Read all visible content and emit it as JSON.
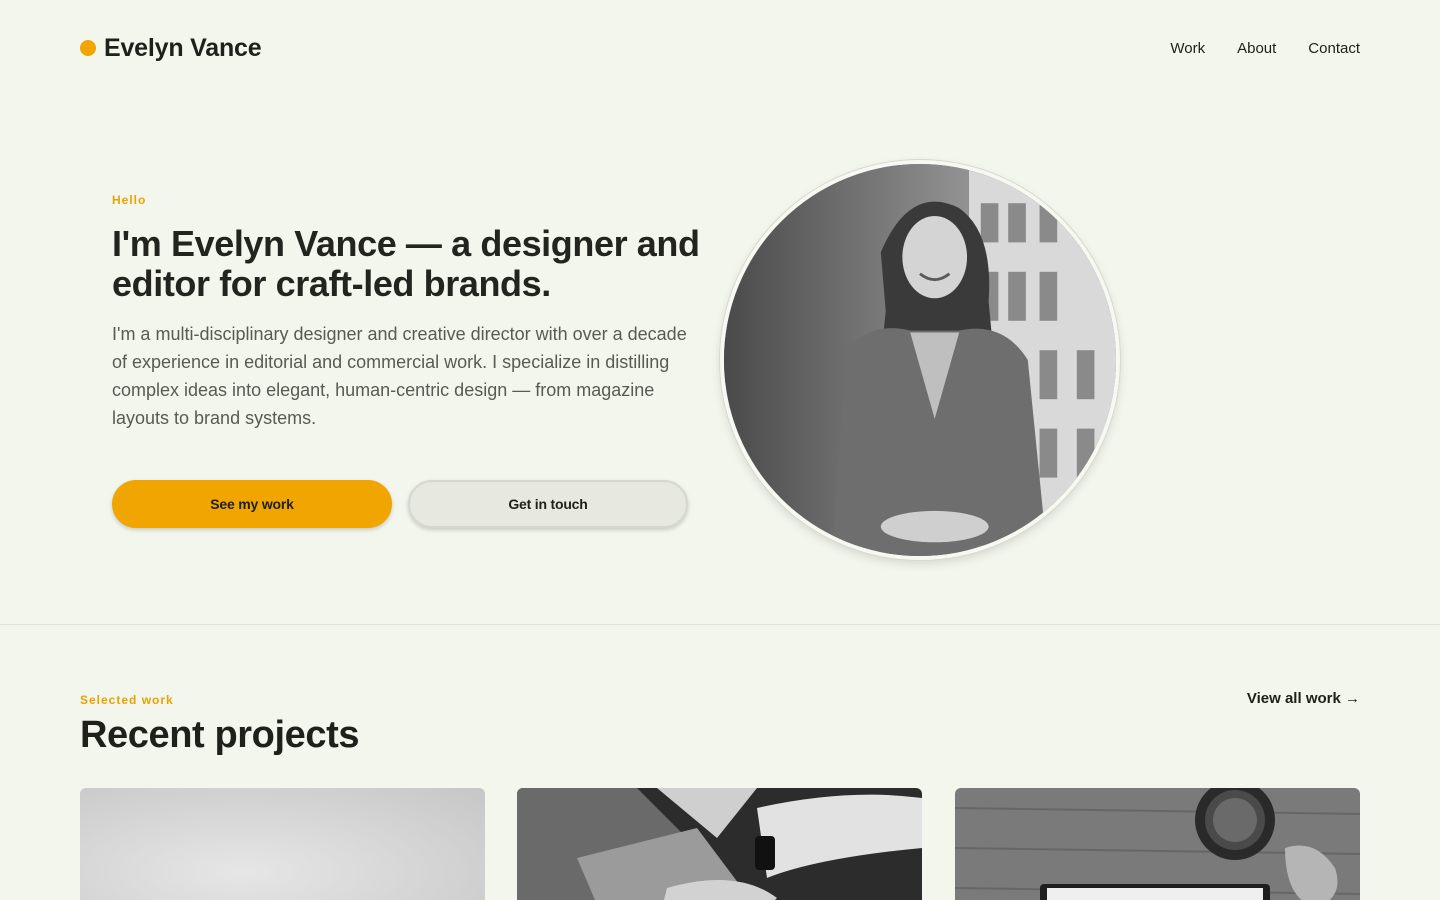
{
  "header": {
    "brand_name": "Evelyn Vance",
    "nav": [
      "Work",
      "About",
      "Contact"
    ]
  },
  "hero": {
    "eyebrow": "Hello",
    "title": "I'm Evelyn Vance — a designer and editor for craft-led brands.",
    "lede": "I'm a multi-disciplinary designer and creative director with over a decade of experience in editorial and commercial work. I specialize in distilling complex ideas into elegant, human-centric design — from magazine layouts to brand systems.",
    "primary_cta": "See my work",
    "secondary_cta": "Get in touch"
  },
  "projects": {
    "eyebrow": "Selected work",
    "title": "Recent projects",
    "view_all": "View all work →"
  },
  "colors": {
    "accent": "#f0a500",
    "background": "#f3f6ec"
  }
}
